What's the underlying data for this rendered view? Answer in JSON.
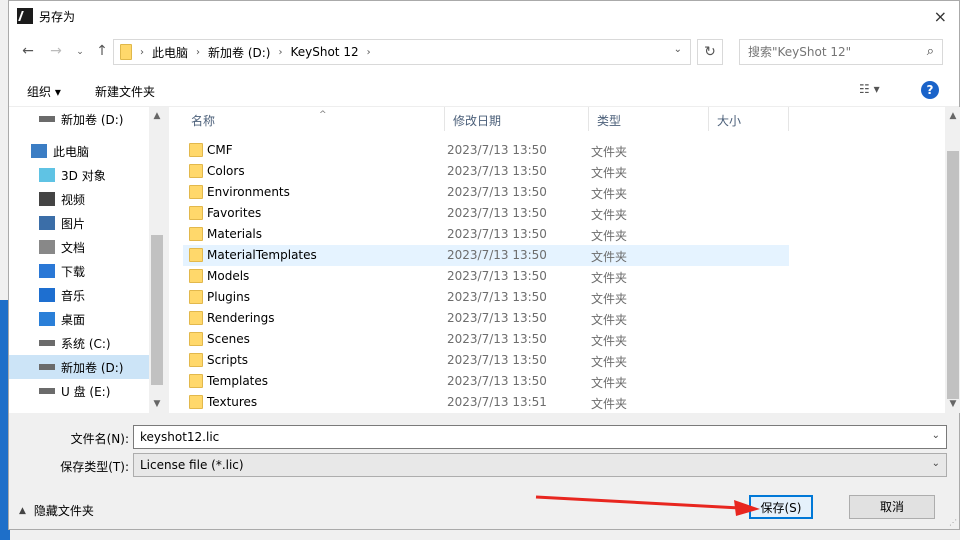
{
  "window": {
    "title": "另存为",
    "close_icon": "×"
  },
  "nav": {
    "back_icon": "←",
    "forward_icon": "→",
    "recent_icon": "⌄",
    "up_icon": "↑",
    "breadcrumbs": [
      "此电脑",
      "新加卷 (D:)",
      "KeyShot 12"
    ],
    "dropdown_icon": "⌄",
    "refresh_icon": "↻",
    "search_placeholder": "搜索\"KeyShot 12\"",
    "search_icon": "⌕"
  },
  "toolbar": {
    "organize_label": "组织 ▾",
    "new_folder_label": "新建文件夹",
    "view_label": "☷ ▾",
    "help_label": "?"
  },
  "sidebar": {
    "items": [
      {
        "label": "新加卷 (D:)",
        "icon": "drive-icon"
      },
      {
        "label": "此电脑",
        "icon": "computer-icon"
      },
      {
        "label": "3D 对象",
        "icon": "3d-objects-icon"
      },
      {
        "label": "视频",
        "icon": "video-icon"
      },
      {
        "label": "图片",
        "icon": "pictures-icon"
      },
      {
        "label": "文档",
        "icon": "documents-icon"
      },
      {
        "label": "下载",
        "icon": "download-icon"
      },
      {
        "label": "音乐",
        "icon": "music-icon"
      },
      {
        "label": "桌面",
        "icon": "desktop-icon"
      },
      {
        "label": "系统 (C:)",
        "icon": "drive-icon"
      },
      {
        "label": "新加卷 (D:)",
        "icon": "drive-icon"
      },
      {
        "label": "U 盘 (E:)",
        "icon": "usb-drive-icon"
      }
    ],
    "selected_index": 10
  },
  "filelist": {
    "columns": [
      "名称",
      "修改日期",
      "类型",
      "大小"
    ],
    "rows": [
      {
        "name": "CMF",
        "date": "2023/7/13 13:50",
        "type": "文件夹"
      },
      {
        "name": "Colors",
        "date": "2023/7/13 13:50",
        "type": "文件夹"
      },
      {
        "name": "Environments",
        "date": "2023/7/13 13:50",
        "type": "文件夹"
      },
      {
        "name": "Favorites",
        "date": "2023/7/13 13:50",
        "type": "文件夹"
      },
      {
        "name": "Materials",
        "date": "2023/7/13 13:50",
        "type": "文件夹"
      },
      {
        "name": "MaterialTemplates",
        "date": "2023/7/13 13:50",
        "type": "文件夹"
      },
      {
        "name": "Models",
        "date": "2023/7/13 13:50",
        "type": "文件夹"
      },
      {
        "name": "Plugins",
        "date": "2023/7/13 13:50",
        "type": "文件夹"
      },
      {
        "name": "Renderings",
        "date": "2023/7/13 13:50",
        "type": "文件夹"
      },
      {
        "name": "Scenes",
        "date": "2023/7/13 13:50",
        "type": "文件夹"
      },
      {
        "name": "Scripts",
        "date": "2023/7/13 13:50",
        "type": "文件夹"
      },
      {
        "name": "Templates",
        "date": "2023/7/13 13:50",
        "type": "文件夹"
      },
      {
        "name": "Textures",
        "date": "2023/7/13 13:51",
        "type": "文件夹"
      }
    ],
    "hover_index": 5
  },
  "form": {
    "filename_label": "文件名(N):",
    "filename_value": "keyshot12.lic",
    "filetype_label": "保存类型(T):",
    "filetype_value": "License file (*.lic)"
  },
  "footer": {
    "hide_folders_label": "隐藏文件夹",
    "save_label": "保存(S)",
    "cancel_label": "取消"
  },
  "colors": {
    "accent": "#0078d7",
    "selection": "#cce4f7",
    "hover": "#e5f3ff",
    "annotation_arrow": "#e8261f"
  }
}
